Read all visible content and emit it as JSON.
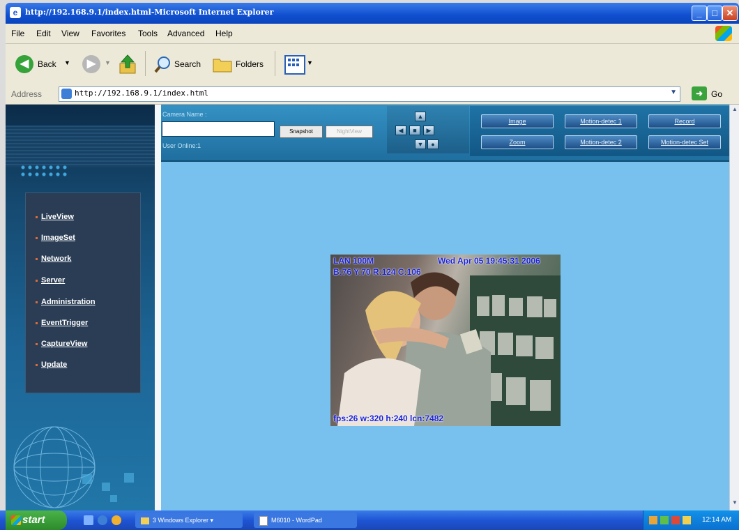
{
  "window": {
    "title": "http://192.168.9.1/index.html-Microsoft Internet Explorer"
  },
  "menu": [
    "File",
    "Edit",
    "View",
    "Favorites",
    "Tools",
    "Advanced",
    "Help"
  ],
  "toolbar": {
    "back_label": "Back",
    "search_label": "Search",
    "folders_label": "Folders"
  },
  "addressbar": {
    "label": "Address",
    "url": "http://192.168.9.1/index.html",
    "go_label": "Go"
  },
  "camera": {
    "name_label": "Camera Name :",
    "name_value": "",
    "snapshot_label": "Snapshot",
    "nightview_label": "NightView",
    "user_online": "User Online:1"
  },
  "controls": {
    "image": "Image",
    "motion1": "Motion-detec 1",
    "record": "Record",
    "zoom": "Zoom",
    "motion2": "Motion-detec 2",
    "motion_set": "Motion-detec Set"
  },
  "sidebar": {
    "items": [
      "LiveView",
      "ImageSet",
      "Network",
      "Server",
      "Administration",
      "EventTrigger",
      "CaptureView",
      "Update"
    ]
  },
  "video": {
    "osd_top_left": "LAN 100M",
    "osd_top_right": "Wed Apr 05 19:45:31 2006",
    "osd_second": "B:76 Y:70 R:124 C:106",
    "osd_bottom": "fps:26 w:320 h:240 lcn:7482"
  },
  "taskbar": {
    "start_label": "start",
    "tasks": [
      "3 Windows Explorer",
      "M6010 - WordPad"
    ],
    "clock": "12:14 AM"
  },
  "colors": {
    "page_bg": "#78c1ee",
    "sidebar": "#164a71",
    "title_bar": "#0f4fcf",
    "osd_text": "#1a22d9"
  }
}
